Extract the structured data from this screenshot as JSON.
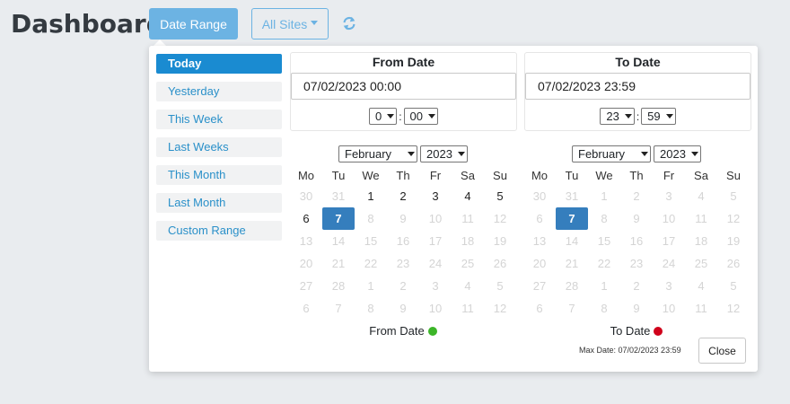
{
  "header": {
    "title": "Dashboard",
    "date_range_label": "Date Range",
    "all_sites_label": "All Sites",
    "refresh_icon": "refresh-icon",
    "accent_color": "#6cb3e3"
  },
  "ranges": [
    {
      "label": "Today",
      "active": true
    },
    {
      "label": "Yesterday",
      "active": false
    },
    {
      "label": "This Week",
      "active": false
    },
    {
      "label": "Last Weeks",
      "active": false
    },
    {
      "label": "This Month",
      "active": false
    },
    {
      "label": "Last Month",
      "active": false
    },
    {
      "label": "Custom Range",
      "active": false
    }
  ],
  "from": {
    "label": "From Date",
    "value": "07/02/2023 00:00",
    "hour": "0",
    "minute": "00",
    "month": "February",
    "year": "2023",
    "legend": "From Date",
    "legend_color": "#3cb528"
  },
  "to": {
    "label": "To Date",
    "value": "07/02/2023 23:59",
    "hour": "23",
    "minute": "59",
    "month": "February",
    "year": "2023",
    "legend": "To Date",
    "legend_color": "#d0021b"
  },
  "weekdays": [
    "Mo",
    "Tu",
    "We",
    "Th",
    "Fr",
    "Sa",
    "Su"
  ],
  "calendars": {
    "from": [
      [
        {
          "d": "30",
          "s": "off"
        },
        {
          "d": "31",
          "s": "off"
        },
        {
          "d": "1",
          "s": "on"
        },
        {
          "d": "2",
          "s": "on"
        },
        {
          "d": "3",
          "s": "on"
        },
        {
          "d": "4",
          "s": "on"
        },
        {
          "d": "5",
          "s": "on"
        }
      ],
      [
        {
          "d": "6",
          "s": "on"
        },
        {
          "d": "7",
          "s": "sel"
        },
        {
          "d": "8",
          "s": "off"
        },
        {
          "d": "9",
          "s": "off"
        },
        {
          "d": "10",
          "s": "off"
        },
        {
          "d": "11",
          "s": "off"
        },
        {
          "d": "12",
          "s": "off"
        }
      ],
      [
        {
          "d": "13",
          "s": "off"
        },
        {
          "d": "14",
          "s": "off"
        },
        {
          "d": "15",
          "s": "off"
        },
        {
          "d": "16",
          "s": "off"
        },
        {
          "d": "17",
          "s": "off"
        },
        {
          "d": "18",
          "s": "off"
        },
        {
          "d": "19",
          "s": "off"
        }
      ],
      [
        {
          "d": "20",
          "s": "off"
        },
        {
          "d": "21",
          "s": "off"
        },
        {
          "d": "22",
          "s": "off"
        },
        {
          "d": "23",
          "s": "off"
        },
        {
          "d": "24",
          "s": "off"
        },
        {
          "d": "25",
          "s": "off"
        },
        {
          "d": "26",
          "s": "off"
        }
      ],
      [
        {
          "d": "27",
          "s": "off"
        },
        {
          "d": "28",
          "s": "off"
        },
        {
          "d": "1",
          "s": "off"
        },
        {
          "d": "2",
          "s": "off"
        },
        {
          "d": "3",
          "s": "off"
        },
        {
          "d": "4",
          "s": "off"
        },
        {
          "d": "5",
          "s": "off"
        }
      ],
      [
        {
          "d": "6",
          "s": "off"
        },
        {
          "d": "7",
          "s": "off"
        },
        {
          "d": "8",
          "s": "off"
        },
        {
          "d": "9",
          "s": "off"
        },
        {
          "d": "10",
          "s": "off"
        },
        {
          "d": "11",
          "s": "off"
        },
        {
          "d": "12",
          "s": "off"
        }
      ]
    ],
    "to": [
      [
        {
          "d": "30",
          "s": "off"
        },
        {
          "d": "31",
          "s": "off"
        },
        {
          "d": "1",
          "s": "off"
        },
        {
          "d": "2",
          "s": "off"
        },
        {
          "d": "3",
          "s": "off"
        },
        {
          "d": "4",
          "s": "off"
        },
        {
          "d": "5",
          "s": "off"
        }
      ],
      [
        {
          "d": "6",
          "s": "off"
        },
        {
          "d": "7",
          "s": "sel"
        },
        {
          "d": "8",
          "s": "off"
        },
        {
          "d": "9",
          "s": "off"
        },
        {
          "d": "10",
          "s": "off"
        },
        {
          "d": "11",
          "s": "off"
        },
        {
          "d": "12",
          "s": "off"
        }
      ],
      [
        {
          "d": "13",
          "s": "off"
        },
        {
          "d": "14",
          "s": "off"
        },
        {
          "d": "15",
          "s": "off"
        },
        {
          "d": "16",
          "s": "off"
        },
        {
          "d": "17",
          "s": "off"
        },
        {
          "d": "18",
          "s": "off"
        },
        {
          "d": "19",
          "s": "off"
        }
      ],
      [
        {
          "d": "20",
          "s": "off"
        },
        {
          "d": "21",
          "s": "off"
        },
        {
          "d": "22",
          "s": "off"
        },
        {
          "d": "23",
          "s": "off"
        },
        {
          "d": "24",
          "s": "off"
        },
        {
          "d": "25",
          "s": "off"
        },
        {
          "d": "26",
          "s": "off"
        }
      ],
      [
        {
          "d": "27",
          "s": "off"
        },
        {
          "d": "28",
          "s": "off"
        },
        {
          "d": "1",
          "s": "off"
        },
        {
          "d": "2",
          "s": "off"
        },
        {
          "d": "3",
          "s": "off"
        },
        {
          "d": "4",
          "s": "off"
        },
        {
          "d": "5",
          "s": "off"
        }
      ],
      [
        {
          "d": "6",
          "s": "off"
        },
        {
          "d": "7",
          "s": "off"
        },
        {
          "d": "8",
          "s": "off"
        },
        {
          "d": "9",
          "s": "off"
        },
        {
          "d": "10",
          "s": "off"
        },
        {
          "d": "11",
          "s": "off"
        },
        {
          "d": "12",
          "s": "off"
        }
      ]
    ]
  },
  "footer": {
    "max_date": "Max Date: 07/02/2023 23:59",
    "close_label": "Close"
  }
}
